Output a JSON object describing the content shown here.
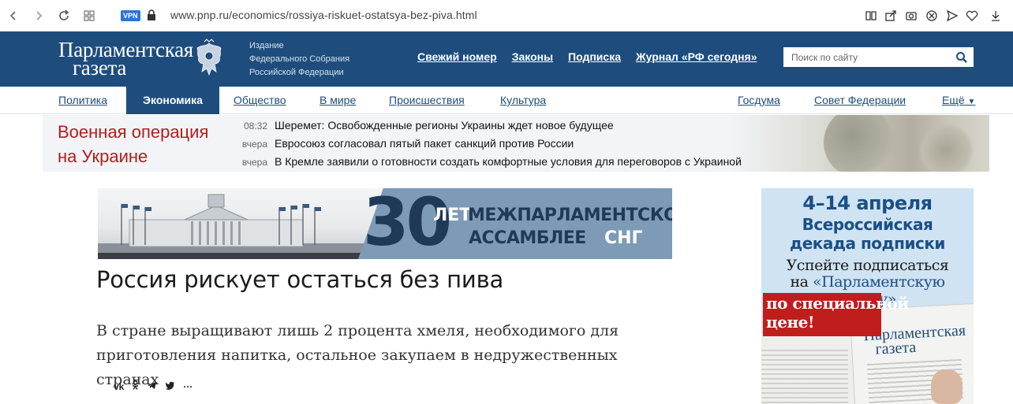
{
  "browser": {
    "url": "www.pnp.ru/economics/rossiya-riskuet-ostatsya-bez-piva.html",
    "vpn_label": "VPN"
  },
  "header": {
    "logo_line1": "Парламентская",
    "logo_line2": "газета",
    "publisher_line1": "Издание",
    "publisher_line2": "Федерального Собрания",
    "publisher_line3": "Российской Федерации",
    "nav": [
      "Свежий номер",
      "Законы",
      "Подписка",
      "Журнал «РФ сегодня»"
    ],
    "search_placeholder": "Поиск по сайту"
  },
  "sections": {
    "left": [
      "Политика",
      "Экономика",
      "Общество",
      "В мире",
      "Происшествия",
      "Культура"
    ],
    "active": "Экономика",
    "right": [
      "Госдума",
      "Совет Федерации",
      "Ещё"
    ]
  },
  "news_strip": {
    "title_line1": "Военная операция",
    "title_line2": "на Украине",
    "items": [
      {
        "time": "08:32",
        "headline": "Шеремет: Освобожденные регионы Украины ждет новое будущее"
      },
      {
        "time": "вчера",
        "headline": "Евросоюз согласовал пятый пакет санкций против России"
      },
      {
        "time": "вчера",
        "headline": "В Кремле заявили о готовности создать комфортные условия для переговоров с Украиной"
      }
    ]
  },
  "banner": {
    "number": "30",
    "let": "ЛЕТ",
    "line1": "МЕЖПАРЛАМЕНТСКОЙ",
    "line2": "АССАМБЛЕЕ",
    "line2b": "СНГ"
  },
  "article": {
    "title": "Россия рискует остаться без пива",
    "lead": "В стране выращивают лишь 2 процента хмеля, необходимого для приготовления напитка, остальное закупаем в недружественных странах",
    "share": [
      "vk",
      "ok",
      "telegram",
      "twitter",
      "more"
    ]
  },
  "side_ad": {
    "date": "4–14 апреля",
    "line2": "Всероссийская",
    "line3": "декада подписки",
    "line4": "Успейте подписаться",
    "line5a": "на",
    "line5b": "«Парламентскую газету»",
    "red1": "по специальной",
    "red2": "цене!",
    "paper_title1": "Парламентская",
    "paper_title2": "газета"
  },
  "colors": {
    "brand_blue": "#1e4d7d",
    "strip_red": "#b51c1c"
  }
}
